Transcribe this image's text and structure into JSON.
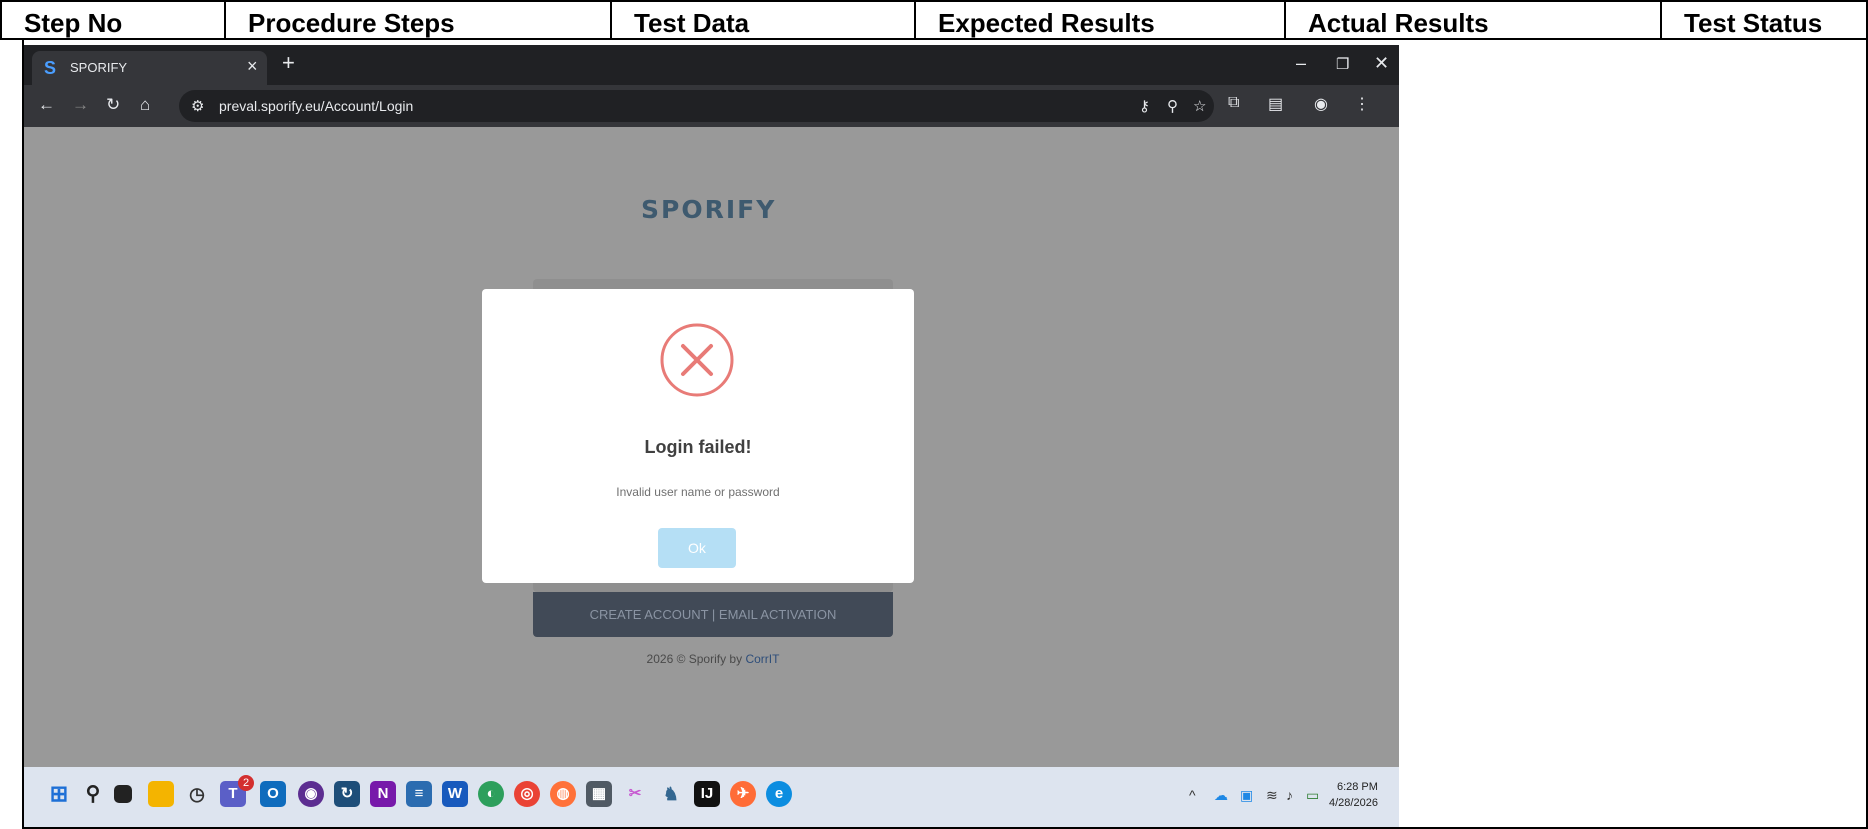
{
  "table": {
    "headers": [
      "Step No",
      "Procedure Steps",
      "Test Data",
      "Expected Results",
      "Actual Results",
      "Test Status"
    ]
  },
  "browser": {
    "tab_title": "SPORIFY",
    "tab_close": "×",
    "new_tab": "+",
    "url": "preval.sporify.eu/Account/Login"
  },
  "page": {
    "logo": "SPORIFY",
    "create_account": "CREATE ACCOUNT | EMAIL ACTIVATION",
    "footer_prefix": "2026 © Sporify by ",
    "footer_link": "CorrIT"
  },
  "modal": {
    "title": "Login failed!",
    "message": "Invalid user name or password",
    "ok_label": "Ok",
    "error_color": "#e87b77"
  },
  "taskbar": {
    "badge": "2",
    "time": "6:28 PM",
    "date": "4/28/2026"
  }
}
